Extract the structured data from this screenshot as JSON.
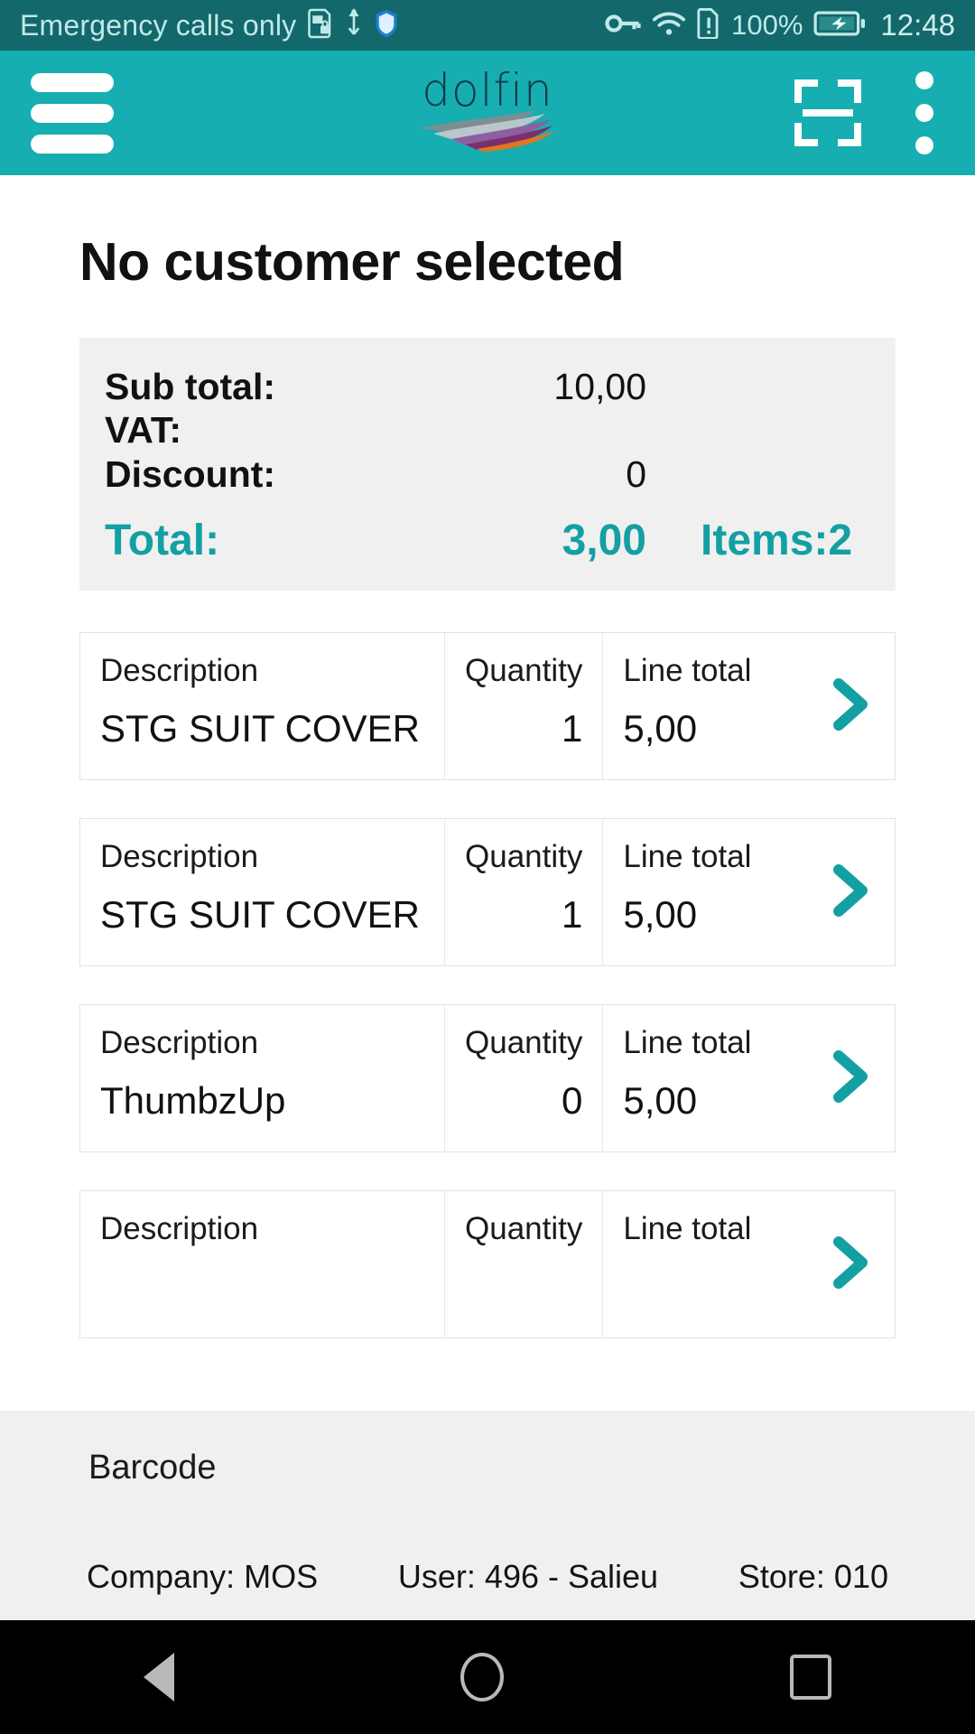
{
  "statusbar": {
    "carrier_text": "Emergency calls only",
    "icons": [
      "sim-lock-icon",
      "usb-icon",
      "shield-icon",
      "vpn-key-icon",
      "wifi-icon",
      "sim-alert-icon"
    ],
    "battery_percent": "100%",
    "battery_state": "charging",
    "time": "12:48",
    "bg_color": "#13686b",
    "fg_color": "#bfe9e7"
  },
  "appbar": {
    "menu_icon": "hamburger-menu-icon",
    "logo_text": "dolfin",
    "scan_icon": "barcode-scan-icon",
    "overflow_icon": "more-vertical-icon",
    "bg_color": "#16aeb0"
  },
  "main": {
    "page_title": "No customer selected",
    "totals": {
      "subtotal_label": "Sub total:",
      "subtotal_value": "10,00",
      "vat_label": "VAT:",
      "vat_value": "",
      "discount_label": "Discount:",
      "discount_value": "0",
      "total_label": "Total:",
      "total_value": "3,00",
      "items_text": "Items:2",
      "accent_color": "#13a0a3",
      "bg_color": "#f0f0f0"
    },
    "line_headers": {
      "description": "Description",
      "quantity": "Quantity",
      "line_total": "Line total"
    },
    "lines": [
      {
        "description": "STG SUIT COVER",
        "quantity": "1",
        "line_total": "5,00",
        "chevron": "›"
      },
      {
        "description": "STG SUIT COVER",
        "quantity": "1",
        "line_total": "5,00",
        "chevron": "›"
      },
      {
        "description": "ThumbzUp",
        "quantity": "0",
        "line_total": "5,00",
        "chevron": "›"
      },
      {
        "description": "",
        "quantity": "",
        "line_total": "",
        "chevron": "›"
      }
    ]
  },
  "bottom": {
    "barcode_label": "Barcode",
    "barcode_value": "",
    "underline_color": "#5ec9c6"
  },
  "footer": {
    "company": "Company: MOS",
    "user": "User: 496 - Salieu",
    "store": "Store: 010"
  },
  "navbar": {
    "back": "back-icon",
    "home": "home-icon",
    "recents": "recents-icon"
  }
}
